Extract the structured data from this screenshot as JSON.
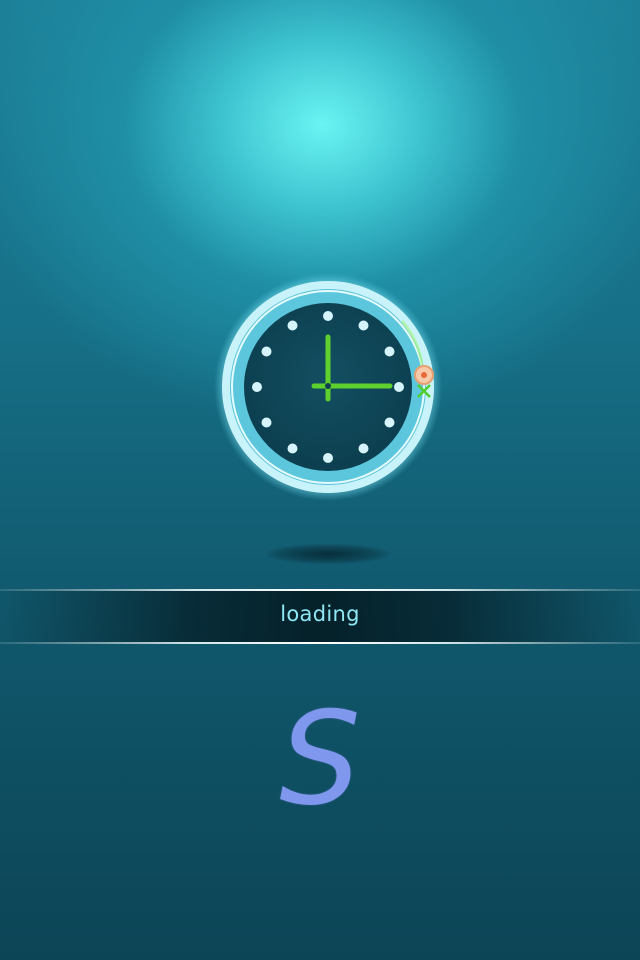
{
  "status": {
    "loading_label": "loading"
  },
  "logo": {
    "text": "S",
    "color": "#7f97ec"
  },
  "clock": {
    "hour": 3,
    "minute": 0,
    "hand_color": "#5fd12e",
    "ring_color": "#d8f8ff",
    "face_color": "#0f4656"
  }
}
